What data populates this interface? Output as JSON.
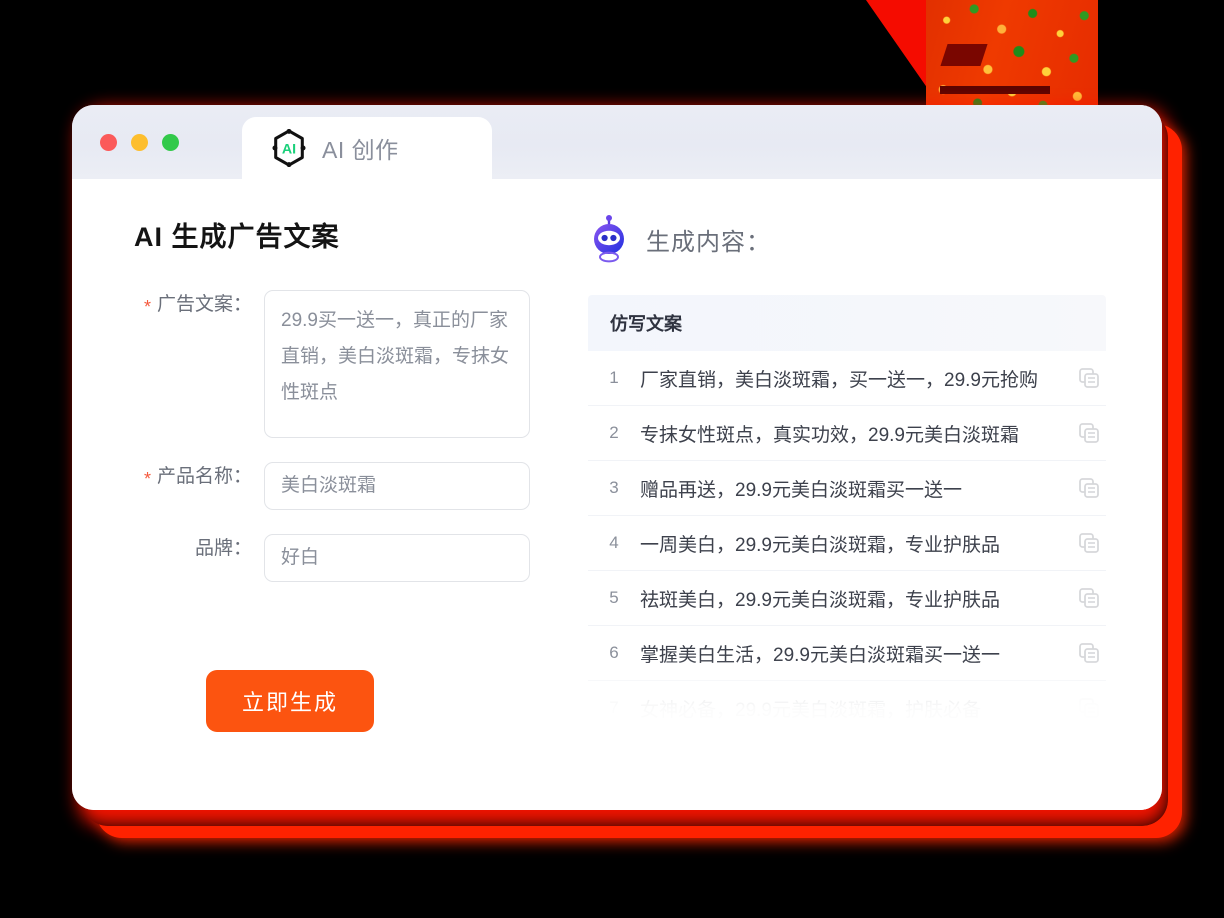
{
  "window": {
    "traffic_lights": [
      {
        "name": "close",
        "color": "#fb5a5a"
      },
      {
        "name": "minimize",
        "color": "#fdbe2e"
      },
      {
        "name": "maximize",
        "color": "#32c94a"
      }
    ],
    "tab": {
      "label": "AI 创作",
      "logo_icon": "ai-hexagon-logo-icon",
      "logo_text": "AI",
      "logo_color": "#19d07a"
    }
  },
  "left_panel": {
    "title": "AI 生成广告文案",
    "fields": [
      {
        "label": "广告文案：",
        "required": true,
        "type": "textarea",
        "value": "29.9买一送一，真正的厂家直销，美白淡斑霜，专抹女性斑点"
      },
      {
        "label": "产品名称：",
        "required": true,
        "type": "input",
        "value": "美白淡斑霜"
      },
      {
        "label": "品牌：",
        "required": false,
        "type": "input",
        "value": "好白"
      }
    ],
    "submit_button": {
      "label": "立即生成",
      "color": "#fc5410"
    }
  },
  "right_panel": {
    "icon": "robot-icon",
    "title": "生成内容：",
    "table": {
      "header": "仿写文案",
      "copy_icon": "copy-icon",
      "rows": [
        {
          "num": "1",
          "text": "厂家直销，美白淡斑霜，买一送一，29.9元抢购"
        },
        {
          "num": "2",
          "text": "专抹女性斑点，真实功效，29.9元美白淡斑霜"
        },
        {
          "num": "3",
          "text": "赠品再送，29.9元美白淡斑霜买一送一"
        },
        {
          "num": "4",
          "text": "一周美白，29.9元美白淡斑霜，专业护肤品"
        },
        {
          "num": "5",
          "text": "祛斑美白，29.9元美白淡斑霜，专业护肤品"
        },
        {
          "num": "6",
          "text": "掌握美白生活，29.9元美白淡斑霜买一送一"
        },
        {
          "num": "7",
          "text": "女神必备，29.9元美白淡斑霜，护肤必备"
        }
      ]
    }
  },
  "theme": {
    "accent": "#fc5410",
    "required_mark": "#f5593d",
    "titlebar": "#e8eaf3",
    "glow": "#ff1500"
  }
}
